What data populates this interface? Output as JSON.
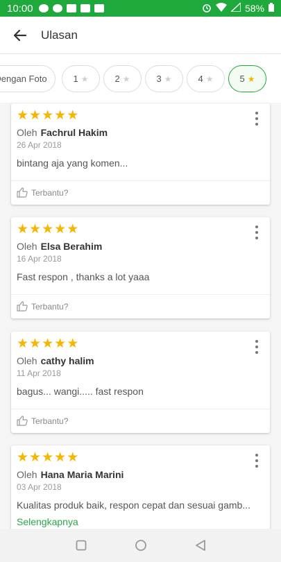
{
  "status_bar": {
    "time": "10:00",
    "battery": "58%",
    "left_icons": [
      "message-icon",
      "chat-icon",
      "broom-icon",
      "mail-icon",
      "mail-icon"
    ],
    "right_icons": [
      "alarm-icon",
      "wifi-icon",
      "signal-icon",
      "battery-icon"
    ]
  },
  "header": {
    "title": "Ulasan"
  },
  "filters": [
    {
      "label": "Dengan Foto",
      "star": ""
    },
    {
      "label": "1",
      "star": "★"
    },
    {
      "label": "2",
      "star": "★"
    },
    {
      "label": "3",
      "star": "★"
    },
    {
      "label": "4",
      "star": "★"
    },
    {
      "label": "5",
      "star": "★",
      "selected": true
    }
  ],
  "reviews": [
    {
      "rating": 5,
      "by": "Oleh",
      "author": "Fachrul Hakim",
      "date": "26 Apr 2018",
      "comment": "bintang aja yang komen...",
      "helpful": "Terbantu?"
    },
    {
      "rating": 5,
      "by": "Oleh",
      "author": "Elsa Berahim",
      "date": "16 Apr 2018",
      "comment": "Fast respon , thanks a lot yaaa",
      "helpful": "Terbantu?"
    },
    {
      "rating": 5,
      "by": "Oleh",
      "author": "cathy halim",
      "date": "11 Apr 2018",
      "comment": "bagus... wangi..... fast respon",
      "helpful": "Terbantu?"
    },
    {
      "rating": 5,
      "by": "Oleh",
      "author": "Hana Maria Marini",
      "date": "03 Apr 2018",
      "comment": "Kualitas produk baik, respon cepat dan sesuai gamb...",
      "more": "Selengkapnya"
    }
  ],
  "colors": {
    "accent": "#1fa83b",
    "star": "#f5b600",
    "link": "#2aa84a"
  }
}
